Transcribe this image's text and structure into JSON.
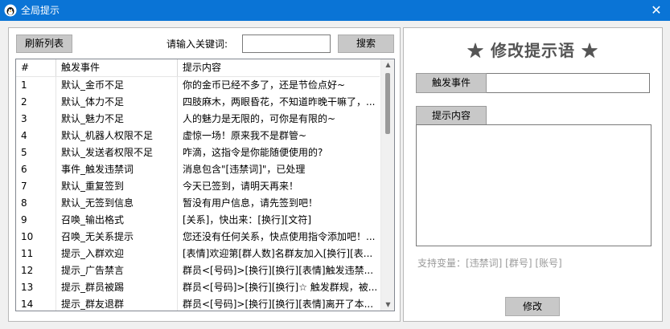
{
  "window": {
    "title": "全局提示"
  },
  "toolbar": {
    "refresh_label": "刷新列表",
    "search_label": "请输入关键词:",
    "search_value": "",
    "search_button_label": "搜索"
  },
  "table": {
    "columns": [
      "#",
      "触发事件",
      "提示内容"
    ],
    "rows": [
      {
        "id": "1",
        "event": "默认_金币不足",
        "content": "你的金币已经不多了，还是节俭点好~"
      },
      {
        "id": "2",
        "event": "默认_体力不足",
        "content": "四肢麻木，两眼昏花，不知道昨晚干嘛了，..."
      },
      {
        "id": "3",
        "event": "默认_魅力不足",
        "content": "人的魅力是无限的，可你是有限的~"
      },
      {
        "id": "4",
        "event": "默认_机器人权限不足",
        "content": "虚惊一场！原来我不是群管~"
      },
      {
        "id": "5",
        "event": "默认_发送者权限不足",
        "content": "咋滴，这指令是你能随便使用的?"
      },
      {
        "id": "6",
        "event": "事件_触发违禁词",
        "content": "消息包含\"[违禁词]\"，已处理"
      },
      {
        "id": "7",
        "event": "默认_重复签到",
        "content": "今天已签到，请明天再来！"
      },
      {
        "id": "8",
        "event": "默认_无签到信息",
        "content": "暂没有用户信息，请先签到吧！"
      },
      {
        "id": "9",
        "event": "召唤_输出格式",
        "content": "[关系]，快出来：[换行][文符]"
      },
      {
        "id": "10",
        "event": "召唤_无关系提示",
        "content": "您还没有任何关系，快点使用指令添加吧！..."
      },
      {
        "id": "11",
        "event": "提示_入群欢迎",
        "content": "[表情]欢迎第[群人数]名群友加入[换行][表..."
      },
      {
        "id": "12",
        "event": "提示_广告禁言",
        "content": "群员<[号码]>[换行][换行][表情]触发违禁..."
      },
      {
        "id": "13",
        "event": "提示_群员被踢",
        "content": "群员<[号码]>[换行][换行]☆ 触发群规，被..."
      },
      {
        "id": "14",
        "event": "提示_群友退群",
        "content": "群员<[号码]>[换行][换行][表情]离开了本..."
      }
    ]
  },
  "editor": {
    "title": "★ 修改提示语 ★",
    "event_label": "触发事件",
    "event_value": "",
    "content_label": "提示内容",
    "content_value": "",
    "vars_text": "支持变量：[违禁词] [群号] [账号]",
    "modify_label": "修改"
  }
}
